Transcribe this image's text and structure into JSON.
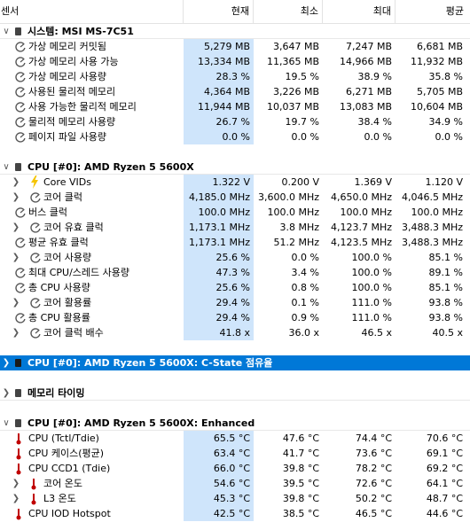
{
  "header": {
    "col_sensor": "센서",
    "col_current": "현재",
    "col_min": "최소",
    "col_max": "최대",
    "col_avg": "평균"
  },
  "rows": [
    {
      "kind": "group",
      "toggle": "expanded",
      "icon": "chip-icon",
      "label": "시스템: MSI MS-7C51"
    },
    {
      "kind": "sensor",
      "indent": 0,
      "icon": "gauge-icon",
      "label": "가상 메모리 커밋됨",
      "cur": "5,279 MB",
      "min": "3,647 MB",
      "max": "7,247 MB",
      "avg": "6,681 MB"
    },
    {
      "kind": "sensor",
      "indent": 0,
      "icon": "gauge-icon",
      "label": "가상 메모리 사용 가능",
      "cur": "13,334 MB",
      "min": "11,365 MB",
      "max": "14,966 MB",
      "avg": "11,932 MB"
    },
    {
      "kind": "sensor",
      "indent": 0,
      "icon": "gauge-icon",
      "label": "가상 메모리 사용량",
      "cur": "28.3 %",
      "min": "19.5 %",
      "max": "38.9 %",
      "avg": "35.8 %"
    },
    {
      "kind": "sensor",
      "indent": 0,
      "icon": "gauge-icon",
      "label": "사용된 물리적 메모리",
      "cur": "4,364 MB",
      "min": "3,226 MB",
      "max": "6,271 MB",
      "avg": "5,705 MB"
    },
    {
      "kind": "sensor",
      "indent": 0,
      "icon": "gauge-icon",
      "label": "사용 가능한 물리적 메모리",
      "cur": "11,944 MB",
      "min": "10,037 MB",
      "max": "13,083 MB",
      "avg": "10,604 MB"
    },
    {
      "kind": "sensor",
      "indent": 0,
      "icon": "gauge-icon",
      "label": "물리적 메모리 사용량",
      "cur": "26.7 %",
      "min": "19.7 %",
      "max": "38.4 %",
      "avg": "34.9 %"
    },
    {
      "kind": "sensor",
      "indent": 0,
      "icon": "gauge-icon",
      "label": "페이지 파일 사용량",
      "cur": "0.0 %",
      "min": "0.0 %",
      "max": "0.0 %",
      "avg": "0.0 %"
    },
    {
      "kind": "blank"
    },
    {
      "kind": "group",
      "toggle": "expanded",
      "icon": "chip-icon",
      "label": "CPU [#0]: AMD Ryzen 5 5600X"
    },
    {
      "kind": "sensor",
      "indent": 0,
      "toggle": "collapsed",
      "icon": "bolt-icon",
      "label": "Core VIDs",
      "cur": "1.322 V",
      "min": "0.200 V",
      "max": "1.369 V",
      "avg": "1.120 V"
    },
    {
      "kind": "sensor",
      "indent": 0,
      "toggle": "collapsed",
      "icon": "gauge-icon",
      "label": "코어 클럭",
      "cur": "4,185.0 MHz",
      "min": "3,600.0 MHz",
      "max": "4,650.0 MHz",
      "avg": "4,046.5 MHz"
    },
    {
      "kind": "sensor",
      "indent": -1,
      "icon": "gauge-icon",
      "label": "버스 클럭",
      "cur": "100.0 MHz",
      "min": "100.0 MHz",
      "max": "100.0 MHz",
      "avg": "100.0 MHz"
    },
    {
      "kind": "sensor",
      "indent": 0,
      "toggle": "collapsed",
      "icon": "gauge-icon",
      "label": "코어 유효 클럭",
      "cur": "1,173.1 MHz",
      "min": "3.8 MHz",
      "max": "4,123.7 MHz",
      "avg": "3,488.3 MHz"
    },
    {
      "kind": "sensor",
      "indent": -1,
      "icon": "gauge-icon",
      "label": "평균 유효 클럭",
      "cur": "1,173.1 MHz",
      "min": "51.2 MHz",
      "max": "4,123.5 MHz",
      "avg": "3,488.3 MHz"
    },
    {
      "kind": "sensor",
      "indent": 0,
      "toggle": "collapsed",
      "icon": "gauge-icon",
      "label": "코어 사용량",
      "cur": "25.6 %",
      "min": "0.0 %",
      "max": "100.0 %",
      "avg": "85.1 %"
    },
    {
      "kind": "sensor",
      "indent": -1,
      "icon": "gauge-icon",
      "label": "최대 CPU/스레드 사용량",
      "cur": "47.3 %",
      "min": "3.4 %",
      "max": "100.0 %",
      "avg": "89.1 %"
    },
    {
      "kind": "sensor",
      "indent": -1,
      "icon": "gauge-icon",
      "label": "총 CPU 사용량",
      "cur": "25.6 %",
      "min": "0.8 %",
      "max": "100.0 %",
      "avg": "85.1 %"
    },
    {
      "kind": "sensor",
      "indent": 0,
      "toggle": "collapsed",
      "icon": "gauge-icon",
      "label": "코어 활용률",
      "cur": "29.4 %",
      "min": "0.1 %",
      "max": "111.0 %",
      "avg": "93.8 %"
    },
    {
      "kind": "sensor",
      "indent": -1,
      "icon": "gauge-icon",
      "label": "총 CPU 활용률",
      "cur": "29.4 %",
      "min": "0.9 %",
      "max": "111.0 %",
      "avg": "93.8 %"
    },
    {
      "kind": "sensor",
      "indent": 0,
      "toggle": "collapsed",
      "icon": "gauge-icon",
      "label": "코어 클럭 배수",
      "cur": "41.8 x",
      "min": "36.0 x",
      "max": "46.5 x",
      "avg": "40.5 x"
    },
    {
      "kind": "blank"
    },
    {
      "kind": "group",
      "toggle": "collapsed",
      "selected": true,
      "icon": "chip-icon",
      "label": "CPU [#0]: AMD Ryzen 5 5600X: C-State 점유율"
    },
    {
      "kind": "blank"
    },
    {
      "kind": "group",
      "toggle": "collapsed",
      "icon": "chip-icon",
      "label": "메모리 타이밍"
    },
    {
      "kind": "blank"
    },
    {
      "kind": "group",
      "toggle": "expanded",
      "icon": "chip-icon",
      "label": "CPU [#0]: AMD Ryzen 5 5600X: Enhanced"
    },
    {
      "kind": "sensor",
      "indent": -1,
      "icon": "thermometer-icon",
      "label": "CPU (Tctl/Tdie)",
      "cur": "65.5 °C",
      "min": "47.6 °C",
      "max": "74.4 °C",
      "avg": "70.6 °C"
    },
    {
      "kind": "sensor",
      "indent": -1,
      "icon": "thermometer-icon",
      "label": "CPU 케이스(평균)",
      "cur": "63.4 °C",
      "min": "41.7 °C",
      "max": "73.6 °C",
      "avg": "69.1 °C"
    },
    {
      "kind": "sensor",
      "indent": -1,
      "icon": "thermometer-icon",
      "label": "CPU CCD1 (Tdie)",
      "cur": "66.0 °C",
      "min": "39.8 °C",
      "max": "78.2 °C",
      "avg": "69.2 °C"
    },
    {
      "kind": "sensor",
      "indent": 0,
      "toggle": "collapsed",
      "icon": "thermometer-icon",
      "label": "코어 온도",
      "cur": "54.6 °C",
      "min": "39.5 °C",
      "max": "72.6 °C",
      "avg": "64.1 °C"
    },
    {
      "kind": "sensor",
      "indent": 0,
      "toggle": "collapsed",
      "icon": "thermometer-icon",
      "label": "L3 온도",
      "cur": "45.3 °C",
      "min": "39.8 °C",
      "max": "50.2 °C",
      "avg": "48.7 °C"
    },
    {
      "kind": "sensor",
      "indent": -1,
      "icon": "thermometer-icon",
      "label": "CPU IOD Hotspot",
      "cur": "42.5 °C",
      "min": "38.5 °C",
      "max": "46.5 °C",
      "avg": "44.6 °C"
    }
  ],
  "colors": {
    "current_column_bg": "#cfe5fb",
    "selection_bg": "#0078d7",
    "thermometer": "#c00000",
    "bolt": "#f5c400"
  }
}
